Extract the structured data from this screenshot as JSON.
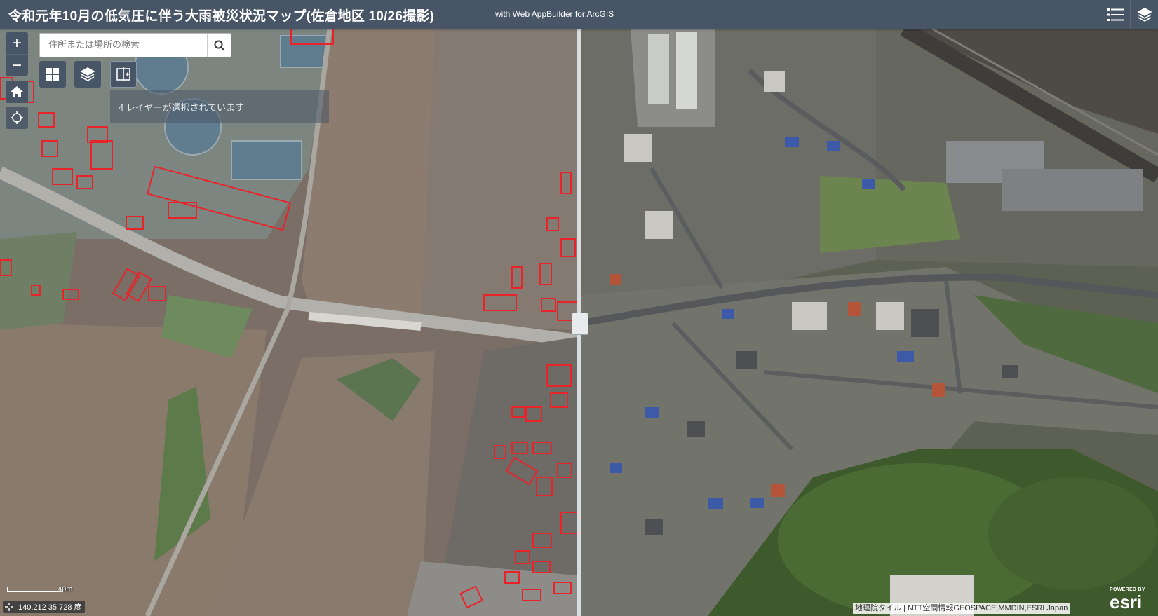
{
  "header": {
    "title": "令和元年10月の低気圧に伴う大雨被災状況マップ(佐倉地区 10/26撮影)",
    "subtitle": "with Web AppBuilder for ArcGIS",
    "legend_icon": "legend-list-icon",
    "layers_icon": "layers-stack-icon"
  },
  "zoom": {
    "in_label": "+",
    "out_label": "−"
  },
  "search": {
    "placeholder": "住所または場所の検索",
    "value": ""
  },
  "widgets": {
    "home_icon": "home-icon",
    "locate_icon": "locate-icon",
    "basemap_gallery_icon": "grid-icon",
    "layer_list_icon": "layers-icon",
    "swipe_icon": "swipe-icon"
  },
  "swipe": {
    "tooltip": "4 レイヤーが選択されています"
  },
  "scalebar": {
    "label": "40m"
  },
  "coordinates": {
    "text": "140.212 35.728 度"
  },
  "attribution": {
    "text": "地理院タイル | NTT空間情報GEOSPACE,MMDIN,ESRI Japan"
  },
  "esri_logo": {
    "powered_by": "POWERED BY",
    "brand": "esri"
  },
  "colors": {
    "header_bg": "#485566",
    "damage_outline": "#e8232a",
    "floodwater": "#8c7a6b"
  }
}
